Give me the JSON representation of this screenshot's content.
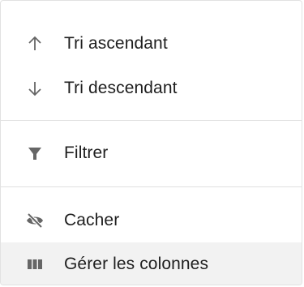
{
  "menu": {
    "items": [
      {
        "label": "Tri ascendant",
        "icon": "arrow-up-icon"
      },
      {
        "label": "Tri descendant",
        "icon": "arrow-down-icon"
      },
      {
        "label": "Filtrer",
        "icon": "filter-icon"
      },
      {
        "label": "Cacher",
        "icon": "eye-slash-icon"
      },
      {
        "label": "Gérer les colonnes",
        "icon": "columns-icon",
        "highlighted": true
      }
    ]
  },
  "colors": {
    "icon": "#666666",
    "text": "#1e1e1e",
    "divider": "#e0e0e0",
    "highlight": "#f2f2f2"
  }
}
